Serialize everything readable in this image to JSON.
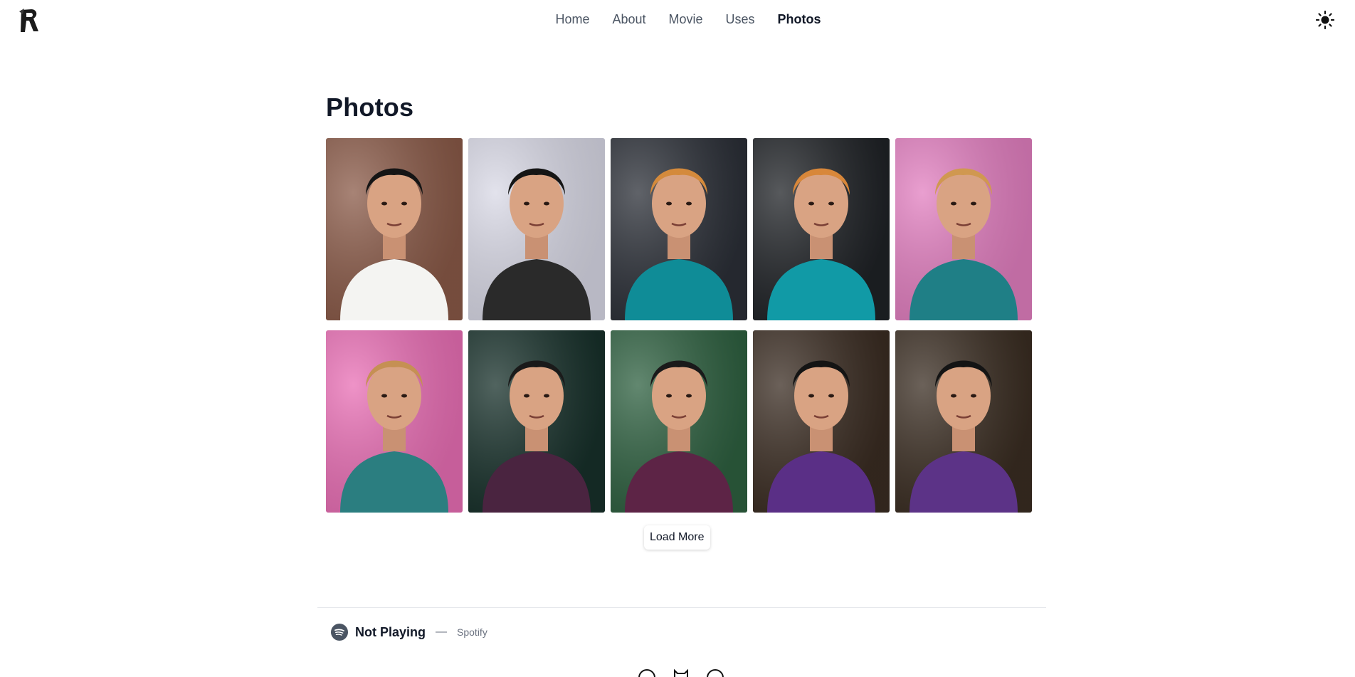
{
  "nav": {
    "items": [
      {
        "label": "Home"
      },
      {
        "label": "About"
      },
      {
        "label": "Movie"
      },
      {
        "label": "Uses"
      },
      {
        "label": "Photos",
        "active": true
      }
    ]
  },
  "page": {
    "title": "Photos"
  },
  "photos": [
    {
      "shirt": "#f4f4f2",
      "bg": "#8a5a48",
      "hair": "#151515"
    },
    {
      "shirt": "#2a2a2a",
      "bg": "#d9d9e6",
      "hair": "#151515"
    },
    {
      "shirt": "#0f8c97",
      "bg": "#2b2f37",
      "hair": "#d48a3c"
    },
    {
      "shirt": "#119aa6",
      "bg": "#1f2226",
      "hair": "#d8873a"
    },
    {
      "shirt": "#1f7f86",
      "bg": "#e27fc0",
      "hair": "#d09850"
    },
    {
      "shirt": "#2b7e80",
      "bg": "#e96fb5",
      "hair": "#c59053"
    },
    {
      "shirt": "#4a2440",
      "bg": "#17302a",
      "hair": "#1a1a1a"
    },
    {
      "shirt": "#5d2446",
      "bg": "#2e6040",
      "hair": "#1a1a1a"
    },
    {
      "shirt": "#5a2f86",
      "bg": "#3a2c22",
      "hair": "#141414"
    },
    {
      "shirt": "#5c3387",
      "bg": "#3a2d22",
      "hair": "#141414"
    }
  ],
  "load_more_label": "Load More",
  "now_playing": {
    "title": "Not Playing",
    "dash": "—",
    "source": "Spotify"
  },
  "icons": {
    "logo": "r-logo",
    "theme": "sun-icon",
    "spotify": "spotify-icon",
    "social": [
      "github-icon",
      "cat-icon",
      "mail-icon"
    ]
  }
}
